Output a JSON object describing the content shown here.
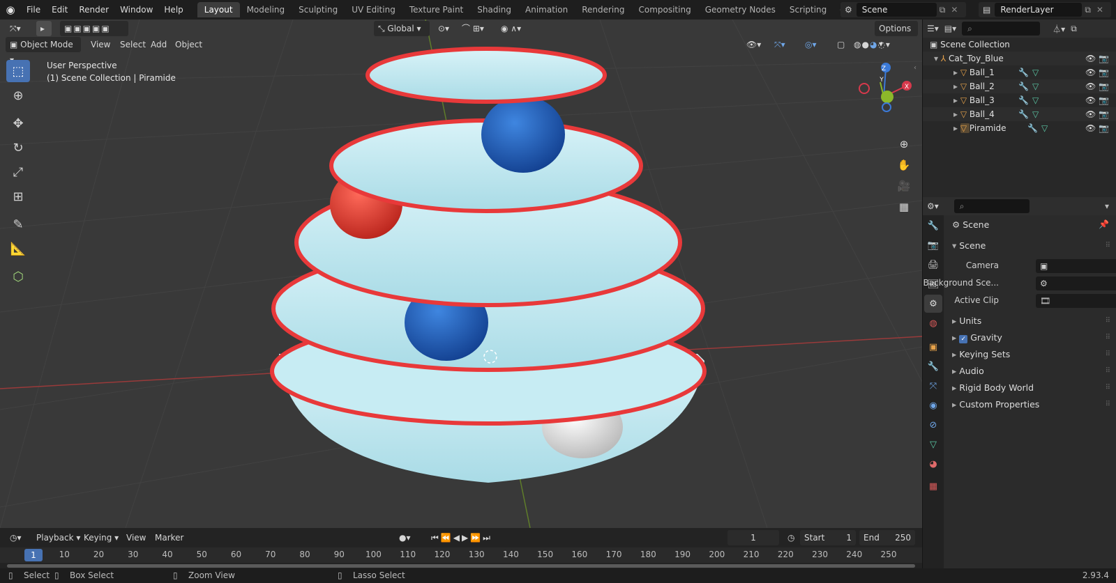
{
  "topbar": {
    "menus": [
      "File",
      "Edit",
      "Render",
      "Window",
      "Help"
    ],
    "workspaces": [
      "Layout",
      "Modeling",
      "Sculpting",
      "UV Editing",
      "Texture Paint",
      "Shading",
      "Animation",
      "Rendering",
      "Compositing",
      "Geometry Nodes",
      "Scripting"
    ],
    "active_workspace": "Layout",
    "add_icon": "plus-icon",
    "scene_name": "Scene",
    "view_layer": "RenderLayer"
  },
  "viewport": {
    "mode": "Object Mode",
    "menus": [
      "View",
      "Select",
      "Add",
      "Object"
    ],
    "orientation": "Global",
    "options": "Options",
    "overlay_line1": "User Perspective",
    "overlay_line2": "(1) Scene Collection | Piramide",
    "gizmo_axes": {
      "z": "Z",
      "y": "Y",
      "x": "X"
    },
    "colors": {
      "x_axis": "#d7394c",
      "y_axis": "#8cb82a",
      "z_axis": "#3b7ad8",
      "background": "#393939",
      "tray": "#bfe8f0",
      "rim": "#e83b3b"
    }
  },
  "timeline": {
    "menus": [
      "Playback",
      "Keying",
      "View",
      "Marker"
    ],
    "current_frame": "1",
    "start_label": "Start",
    "start": "1",
    "end_label": "End",
    "end": "250",
    "ticks": [
      "1",
      "10",
      "20",
      "30",
      "40",
      "50",
      "60",
      "70",
      "80",
      "90",
      "100",
      "110",
      "120",
      "130",
      "140",
      "150",
      "160",
      "170",
      "180",
      "190",
      "200",
      "210",
      "220",
      "230",
      "240",
      "250"
    ]
  },
  "statusbar": {
    "select": "Select",
    "box_select": "Box Select",
    "zoom_view": "Zoom View",
    "lasso_select": "Lasso Select",
    "version": "2.93.4"
  },
  "outliner": {
    "root": "Scene Collection",
    "collection": "Cat_Toy_Blue",
    "items": [
      "Ball_1",
      "Ball_2",
      "Ball_3",
      "Ball_4",
      "Piramide"
    ]
  },
  "properties": {
    "context": "Scene",
    "panel": "Scene",
    "camera_label": "Camera",
    "bg_scene_label": "Background Sce...",
    "active_clip_label": "Active Clip",
    "sections": [
      "Units",
      "Gravity",
      "Keying Sets",
      "Audio",
      "Rigid Body World",
      "Custom Properties"
    ],
    "gravity_checked": true
  }
}
